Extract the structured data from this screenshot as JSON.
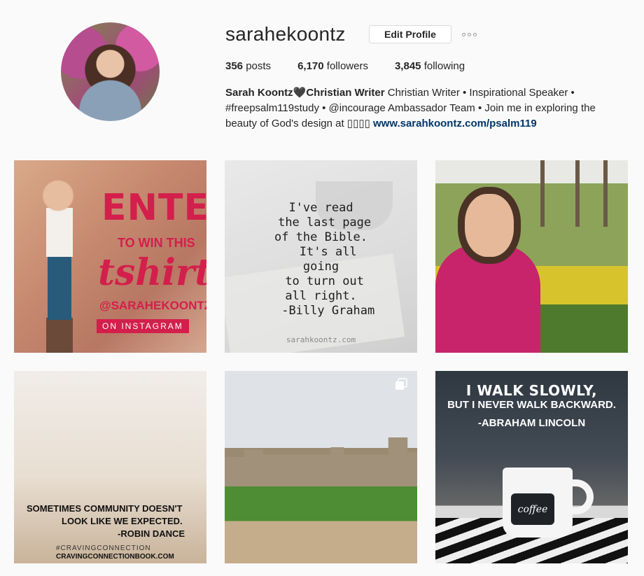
{
  "profile": {
    "username": "sarahekoontz",
    "edit_label": "Edit Profile",
    "stats": {
      "posts_count": "356",
      "posts_label": "posts",
      "followers_count": "6,170",
      "followers_label": "followers",
      "following_count": "3,845",
      "following_label": "following"
    },
    "bio": {
      "name": "Sarah Koontz🖤Christian Writer",
      "line1": " Christian Writer • Inspirational Speaker •",
      "line2": "#freepsalm119study • @incourage Ambassador Team • Join me in exploring the",
      "line3": "beauty of God's design at ▯▯▯▯ ",
      "link": "www.sarahkoontz.com/psalm119"
    }
  },
  "posts": {
    "p1": {
      "enter": "ENTER",
      "towin": "TO WIN THIS",
      "tshirt": "tshirt",
      "handle": "@SARAHEKOONTZ",
      "oninsta": "ON INSTAGRAM"
    },
    "p2": {
      "quote": "I've read\n the last page\nof the Bible.\n  It's all\ngoing\n to turn out\nall right.\n  -Billy Graham",
      "site": "sarahkoontz.com"
    },
    "p4": {
      "l1": "SOMETIMES COMMUNITY DOESN'T",
      "l2": "LOOK LIKE WE EXPECTED.",
      "l3": "-ROBIN DANCE",
      "hash": "#CRAVINGCONNECTION",
      "site": "CRAVINGCONNECTIONBOOK.COM"
    },
    "p6": {
      "l1": "I WALK SLOWLY,",
      "l2": "BUT I NEVER WALK BACKWARD.",
      "l3": "-ABRAHAM LINCOLN",
      "mug": "coffee"
    }
  },
  "icons": {
    "more": "more-options-icon",
    "multi": "multiple-photos-icon"
  },
  "colors": {
    "accent_link": "#003569",
    "enter_red": "#d31f4b"
  }
}
